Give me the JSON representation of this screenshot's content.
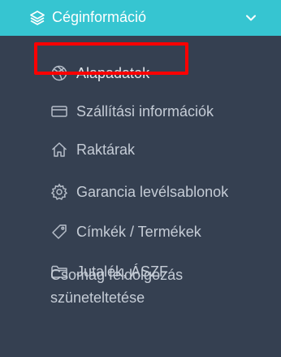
{
  "section": {
    "title": "Céginformáció",
    "icon": "layers-icon",
    "toggle_icon": "chevron-down-icon",
    "expanded": true
  },
  "colors": {
    "header_bg": "#36c5d1",
    "sidebar_bg": "#354051",
    "text": "#c5ccd6",
    "highlight": "#ff0000"
  },
  "items": [
    {
      "label": "Alapadatok",
      "icon": "basketball-icon",
      "active": true
    },
    {
      "label": "Szállítási információk",
      "icon": "credit-card-icon"
    },
    {
      "label": "Raktárak",
      "icon": "home-icon"
    },
    {
      "label": "Garancia levélsablonok",
      "icon": "gear-icon"
    },
    {
      "label": "Címkék / Termékek",
      "icon": "tag-icon"
    },
    {
      "label": "Jutalék, ÁSZF",
      "icon": "folder-icon"
    }
  ],
  "last_item": {
    "line1": "Csomag feldolgozás",
    "line2": "szüneteltetése"
  }
}
